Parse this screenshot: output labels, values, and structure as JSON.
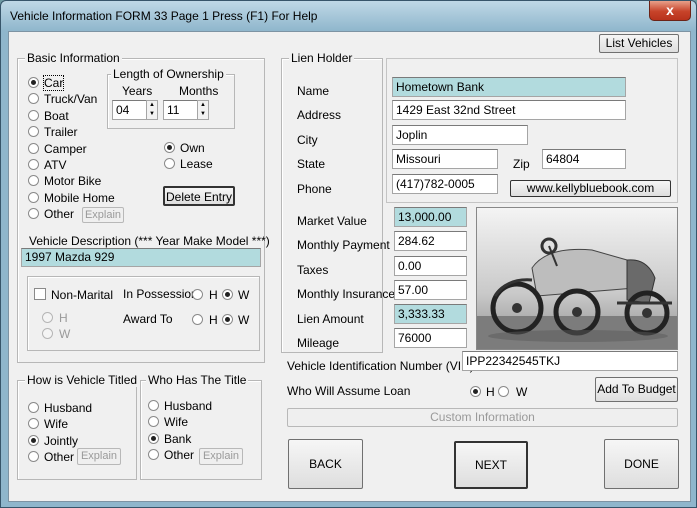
{
  "window": {
    "title": "Vehicle Information  FORM 33   Page 1   Press (F1) For Help",
    "close_glyph": "x"
  },
  "list_vehicles_button": "List Vehicles",
  "basic_info": {
    "legend": "Basic Information",
    "vehicle_types": [
      "Car",
      "Truck/Van",
      "Boat",
      "Trailer",
      "Camper",
      "ATV",
      "Motor Bike",
      "Mobile Home",
      "Other"
    ],
    "selected_type": "Car",
    "explain_label": "Explain",
    "ownership": {
      "legend": "Length of Ownership",
      "years_label": "Years",
      "months_label": "Months",
      "years": "04",
      "months": "11"
    },
    "own_label": "Own",
    "lease_label": "Lease",
    "own_selected": true,
    "delete_entry_label": "Delete Entry",
    "description_label": "Vehicle Description (*** Year Make Model ***)",
    "description_value": "1997 Mazda 929"
  },
  "marital": {
    "non_marital_label": "Non-Marital",
    "h_label": "H",
    "w_label": "W",
    "in_possession_label": "In Possession",
    "award_to_label": "Award To",
    "in_possession_value": "W",
    "award_to_value": "W"
  },
  "titled": {
    "legend": "How is Vehicle Titled",
    "options": [
      "Husband",
      "Wife",
      "Jointly",
      "Other"
    ],
    "selected": "Jointly",
    "explain_label": "Explain"
  },
  "who_has_title": {
    "legend": "Who Has The Title",
    "options": [
      "Husband",
      "Wife",
      "Bank",
      "Other"
    ],
    "selected": "Bank",
    "explain_label": "Explain"
  },
  "lien": {
    "legend": "Lien Holder",
    "labels": {
      "name": "Name",
      "address": "Address",
      "city": "City",
      "state": "State",
      "zip": "Zip",
      "phone": "Phone"
    },
    "name": "Hometown Bank",
    "address": "1429 East 32nd Street",
    "city": "Joplin",
    "state": "Missouri",
    "zip": "64804",
    "phone": "(417)782-0005",
    "website_button": "www.kellybluebook.com"
  },
  "values": {
    "labels": {
      "market_value": "Market Value",
      "monthly_payment": "Monthly Payment",
      "taxes": "Taxes",
      "monthly_insurance": "Monthly Insurance",
      "lien_amount": "Lien Amount",
      "mileage": "Mileage"
    },
    "market_value": "13,000.00",
    "monthly_payment": "284.62",
    "taxes": "0.00",
    "monthly_insurance": "57.00",
    "lien_amount": "3,333.33",
    "mileage": "76000"
  },
  "vin": {
    "label": "Vehicle Identification Number (VIN)",
    "value": "IPP22342545TKJ"
  },
  "assume_loan": {
    "label": "Who  Will Assume Loan",
    "h_label": "H",
    "w_label": "W",
    "selected": "H"
  },
  "add_to_budget": "Add To Budget",
  "custom_information": "Custom Information",
  "nav": {
    "back": "BACK",
    "next": "NEXT",
    "done": "DONE"
  },
  "colors": {
    "teal_field": "#b2dbde",
    "titlebar": "#8fb6cc",
    "close_red": "#c7432a"
  }
}
